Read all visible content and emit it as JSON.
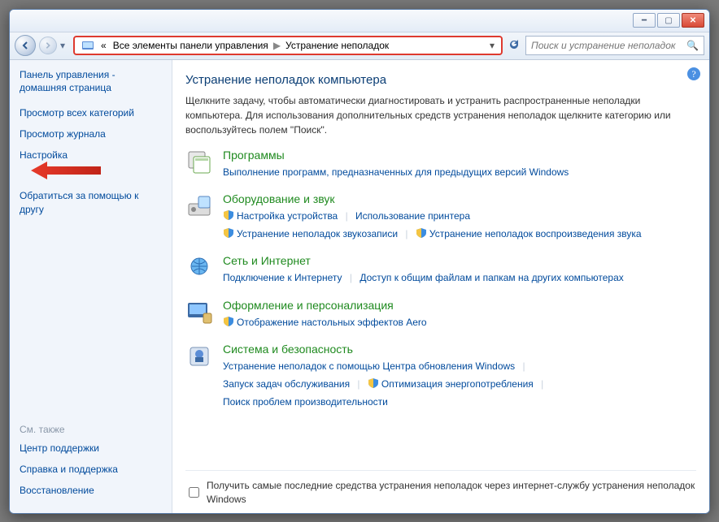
{
  "breadcrumb": {
    "chevrons": "«",
    "parent": "Все элементы панели управления",
    "current": "Устранение неполадок"
  },
  "search": {
    "placeholder": "Поиск и устранение неполадок"
  },
  "sidebar": {
    "home": "Панель управления - домашняя страница",
    "items": [
      "Просмотр всех категорий",
      "Просмотр журнала",
      "Настройка",
      "Обратиться за помощью к другу"
    ],
    "seeAlso": "См. также",
    "bottom": [
      "Центр поддержки",
      "Справка и поддержка",
      "Восстановление"
    ]
  },
  "main": {
    "title": "Устранение неполадок компьютера",
    "intro": "Щелкните задачу, чтобы автоматически диагностировать и устранить распространенные неполадки компьютера. Для использования дополнительных средств устранения неполадок щелкните категорию или воспользуйтесь полем \"Поиск\"."
  },
  "cats": {
    "programs": {
      "title": "Программы",
      "desc": "Выполнение программ, предназначенных для предыдущих версий Windows"
    },
    "hardware": {
      "title": "Оборудование и звук",
      "l1": "Настройка устройства",
      "l2": "Использование принтера",
      "l3": "Устранение неполадок звукозаписи",
      "l4": "Устранение неполадок воспроизведения звука"
    },
    "network": {
      "title": "Сеть и Интернет",
      "l1": "Подключение к Интернету",
      "l2": "Доступ к общим файлам и папкам на других компьютерах"
    },
    "appearance": {
      "title": "Оформление и персонализация",
      "l1": "Отображение настольных эффектов Aero"
    },
    "security": {
      "title": "Система и безопасность",
      "l1": "Устранение неполадок с помощью Центра обновления Windows",
      "l2": "Запуск задач обслуживания",
      "l3": "Оптимизация энергопотребления",
      "l4": "Поиск проблем производительности"
    }
  },
  "footer": {
    "label": "Получить самые последние средства устранения неполадок через интернет-службу устранения неполадок Windows"
  }
}
